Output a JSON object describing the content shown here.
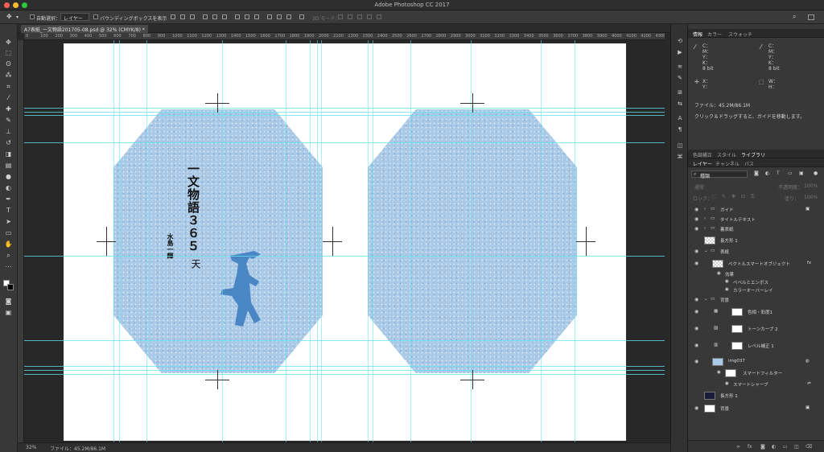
{
  "window": {
    "title": "Adobe Photoshop CC 2017",
    "traffic_colors": [
      "#ff5f57",
      "#febc2e",
      "#28c840"
    ]
  },
  "options_bar": {
    "auto_select_label": "自動選択：",
    "auto_select_target": "レイヤー",
    "bounding_box_label": "バウンディングボックスを表示",
    "mode_3d_label": "3D モード："
  },
  "document": {
    "tab_title": "A7表紙_一文物語201705-08.psd @ 32% (CMYK/8) *"
  },
  "ruler": {
    "ticks": [
      "0",
      "100",
      "200",
      "300",
      "400",
      "500",
      "600",
      "700",
      "800",
      "900",
      "1000",
      "1100",
      "1200",
      "1300",
      "1400",
      "1500",
      "1600",
      "1700",
      "1800",
      "1900",
      "2000",
      "2100",
      "2200",
      "2300",
      "2400",
      "2500",
      "2600",
      "2700",
      "2800",
      "2900",
      "3000",
      "3100",
      "3200",
      "3300",
      "3400",
      "3500",
      "3600",
      "3700",
      "3800",
      "3900",
      "4000",
      "4100",
      "4200",
      "4300"
    ]
  },
  "artwork": {
    "title_vertical": "一文物語３６５",
    "subtitle_vertical": "天",
    "author_vertical": "水島一輝",
    "pattern_color": "#a9c9e6",
    "figure_color": "#4a86c3"
  },
  "status": {
    "zoom": "32%",
    "file_info": "ファイル：45.2M/86.1M"
  },
  "info_panel": {
    "tabs": [
      "情報",
      "カラー",
      "スウォッチ"
    ],
    "cmyk_left": [
      "C：",
      "M：",
      "Y：",
      "K："
    ],
    "cmyk_right": [
      "C：",
      "M：",
      "Y：",
      "K："
    ],
    "bits_left": "8 bit",
    "bits_right": "8 bit",
    "x_label": "X：",
    "y_label": "Y：",
    "w_label": "W：",
    "h_label": "H：",
    "file": "ファイル：45.2M/86.1M",
    "hint": "クリック＆ドラッグすると、ガイドを移動します。"
  },
  "adjust_tabs": [
    "色調補正",
    "スタイル",
    "ライブラリ"
  ],
  "layers_panel": {
    "tabs": [
      "レイヤー",
      "チャンネル",
      "パス"
    ],
    "filter_kind": "種類",
    "blend_mode": "通常",
    "opacity_label": "不透明度：",
    "opacity_value": "100%",
    "lock_label": "ロック：",
    "fill_label": "塗り：",
    "fill_value": "100%",
    "layers": [
      {
        "name": "ガイド",
        "kind": "group"
      },
      {
        "name": "タイトルテキスト",
        "kind": "group"
      },
      {
        "name": "裏表紙",
        "kind": "group"
      },
      {
        "name": "長方形 1",
        "kind": "layer"
      },
      {
        "name": "表紙",
        "kind": "group"
      },
      {
        "name": "ベクトルスマートオブジェクト",
        "kind": "layer"
      },
      {
        "name": "効果",
        "kind": "effect"
      },
      {
        "name": "ベベルとエンボス",
        "kind": "effect"
      },
      {
        "name": "カラーオーバーレイ",
        "kind": "effect"
      },
      {
        "name": "背景",
        "kind": "group"
      },
      {
        "name": "色相・彩度1",
        "kind": "adjust"
      },
      {
        "name": "トーンカーブ 2",
        "kind": "adjust"
      },
      {
        "name": "レベル補正 1",
        "kind": "adjust"
      },
      {
        "name": "img037",
        "kind": "layer"
      },
      {
        "name": "スマートフィルター",
        "kind": "effect"
      },
      {
        "name": "スマートシャープ",
        "kind": "effect"
      },
      {
        "name": "長方形 1",
        "kind": "layer"
      },
      {
        "name": "背景",
        "kind": "layer"
      }
    ],
    "footer_icons": [
      "link-icon",
      "fx-icon",
      "mask-icon",
      "adjustment-icon",
      "folder-icon",
      "new-layer-icon",
      "trash-icon"
    ]
  },
  "accent": "#5fe3f0"
}
